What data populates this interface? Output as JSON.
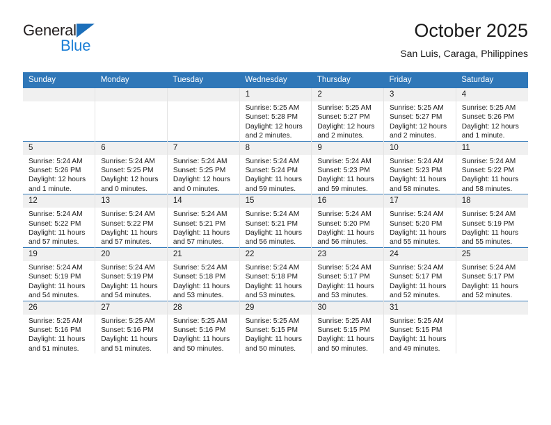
{
  "brand": {
    "name_top": "General",
    "name_bottom": "Blue",
    "triangle_color": "#1c6fba",
    "blue_text_color": "#1c7fd6"
  },
  "header": {
    "title": "October 2025",
    "subtitle": "San Luis, Caraga, Philippines",
    "header_bg": "#2f77b8",
    "header_text_color": "#ffffff",
    "daynum_bg": "#f0f0f0"
  },
  "weekday_headers": [
    "Sunday",
    "Monday",
    "Tuesday",
    "Wednesday",
    "Thursday",
    "Friday",
    "Saturday"
  ],
  "labels": {
    "sunrise": "Sunrise:",
    "sunset": "Sunset:",
    "daylight": "Daylight:"
  },
  "weeks": [
    [
      {
        "day": "",
        "sunrise": "",
        "sunset": "",
        "daylight_line1": "",
        "daylight_line2": ""
      },
      {
        "day": "",
        "sunrise": "",
        "sunset": "",
        "daylight_line1": "",
        "daylight_line2": ""
      },
      {
        "day": "",
        "sunrise": "",
        "sunset": "",
        "daylight_line1": "",
        "daylight_line2": ""
      },
      {
        "day": "1",
        "sunrise": "Sunrise: 5:25 AM",
        "sunset": "Sunset: 5:28 PM",
        "daylight_line1": "Daylight: 12 hours",
        "daylight_line2": "and 2 minutes."
      },
      {
        "day": "2",
        "sunrise": "Sunrise: 5:25 AM",
        "sunset": "Sunset: 5:27 PM",
        "daylight_line1": "Daylight: 12 hours",
        "daylight_line2": "and 2 minutes."
      },
      {
        "day": "3",
        "sunrise": "Sunrise: 5:25 AM",
        "sunset": "Sunset: 5:27 PM",
        "daylight_line1": "Daylight: 12 hours",
        "daylight_line2": "and 2 minutes."
      },
      {
        "day": "4",
        "sunrise": "Sunrise: 5:25 AM",
        "sunset": "Sunset: 5:26 PM",
        "daylight_line1": "Daylight: 12 hours",
        "daylight_line2": "and 1 minute."
      }
    ],
    [
      {
        "day": "5",
        "sunrise": "Sunrise: 5:24 AM",
        "sunset": "Sunset: 5:26 PM",
        "daylight_line1": "Daylight: 12 hours",
        "daylight_line2": "and 1 minute."
      },
      {
        "day": "6",
        "sunrise": "Sunrise: 5:24 AM",
        "sunset": "Sunset: 5:25 PM",
        "daylight_line1": "Daylight: 12 hours",
        "daylight_line2": "and 0 minutes."
      },
      {
        "day": "7",
        "sunrise": "Sunrise: 5:24 AM",
        "sunset": "Sunset: 5:25 PM",
        "daylight_line1": "Daylight: 12 hours",
        "daylight_line2": "and 0 minutes."
      },
      {
        "day": "8",
        "sunrise": "Sunrise: 5:24 AM",
        "sunset": "Sunset: 5:24 PM",
        "daylight_line1": "Daylight: 11 hours",
        "daylight_line2": "and 59 minutes."
      },
      {
        "day": "9",
        "sunrise": "Sunrise: 5:24 AM",
        "sunset": "Sunset: 5:23 PM",
        "daylight_line1": "Daylight: 11 hours",
        "daylight_line2": "and 59 minutes."
      },
      {
        "day": "10",
        "sunrise": "Sunrise: 5:24 AM",
        "sunset": "Sunset: 5:23 PM",
        "daylight_line1": "Daylight: 11 hours",
        "daylight_line2": "and 58 minutes."
      },
      {
        "day": "11",
        "sunrise": "Sunrise: 5:24 AM",
        "sunset": "Sunset: 5:22 PM",
        "daylight_line1": "Daylight: 11 hours",
        "daylight_line2": "and 58 minutes."
      }
    ],
    [
      {
        "day": "12",
        "sunrise": "Sunrise: 5:24 AM",
        "sunset": "Sunset: 5:22 PM",
        "daylight_line1": "Daylight: 11 hours",
        "daylight_line2": "and 57 minutes."
      },
      {
        "day": "13",
        "sunrise": "Sunrise: 5:24 AM",
        "sunset": "Sunset: 5:22 PM",
        "daylight_line1": "Daylight: 11 hours",
        "daylight_line2": "and 57 minutes."
      },
      {
        "day": "14",
        "sunrise": "Sunrise: 5:24 AM",
        "sunset": "Sunset: 5:21 PM",
        "daylight_line1": "Daylight: 11 hours",
        "daylight_line2": "and 57 minutes."
      },
      {
        "day": "15",
        "sunrise": "Sunrise: 5:24 AM",
        "sunset": "Sunset: 5:21 PM",
        "daylight_line1": "Daylight: 11 hours",
        "daylight_line2": "and 56 minutes."
      },
      {
        "day": "16",
        "sunrise": "Sunrise: 5:24 AM",
        "sunset": "Sunset: 5:20 PM",
        "daylight_line1": "Daylight: 11 hours",
        "daylight_line2": "and 56 minutes."
      },
      {
        "day": "17",
        "sunrise": "Sunrise: 5:24 AM",
        "sunset": "Sunset: 5:20 PM",
        "daylight_line1": "Daylight: 11 hours",
        "daylight_line2": "and 55 minutes."
      },
      {
        "day": "18",
        "sunrise": "Sunrise: 5:24 AM",
        "sunset": "Sunset: 5:19 PM",
        "daylight_line1": "Daylight: 11 hours",
        "daylight_line2": "and 55 minutes."
      }
    ],
    [
      {
        "day": "19",
        "sunrise": "Sunrise: 5:24 AM",
        "sunset": "Sunset: 5:19 PM",
        "daylight_line1": "Daylight: 11 hours",
        "daylight_line2": "and 54 minutes."
      },
      {
        "day": "20",
        "sunrise": "Sunrise: 5:24 AM",
        "sunset": "Sunset: 5:19 PM",
        "daylight_line1": "Daylight: 11 hours",
        "daylight_line2": "and 54 minutes."
      },
      {
        "day": "21",
        "sunrise": "Sunrise: 5:24 AM",
        "sunset": "Sunset: 5:18 PM",
        "daylight_line1": "Daylight: 11 hours",
        "daylight_line2": "and 53 minutes."
      },
      {
        "day": "22",
        "sunrise": "Sunrise: 5:24 AM",
        "sunset": "Sunset: 5:18 PM",
        "daylight_line1": "Daylight: 11 hours",
        "daylight_line2": "and 53 minutes."
      },
      {
        "day": "23",
        "sunrise": "Sunrise: 5:24 AM",
        "sunset": "Sunset: 5:17 PM",
        "daylight_line1": "Daylight: 11 hours",
        "daylight_line2": "and 53 minutes."
      },
      {
        "day": "24",
        "sunrise": "Sunrise: 5:24 AM",
        "sunset": "Sunset: 5:17 PM",
        "daylight_line1": "Daylight: 11 hours",
        "daylight_line2": "and 52 minutes."
      },
      {
        "day": "25",
        "sunrise": "Sunrise: 5:24 AM",
        "sunset": "Sunset: 5:17 PM",
        "daylight_line1": "Daylight: 11 hours",
        "daylight_line2": "and 52 minutes."
      }
    ],
    [
      {
        "day": "26",
        "sunrise": "Sunrise: 5:25 AM",
        "sunset": "Sunset: 5:16 PM",
        "daylight_line1": "Daylight: 11 hours",
        "daylight_line2": "and 51 minutes."
      },
      {
        "day": "27",
        "sunrise": "Sunrise: 5:25 AM",
        "sunset": "Sunset: 5:16 PM",
        "daylight_line1": "Daylight: 11 hours",
        "daylight_line2": "and 51 minutes."
      },
      {
        "day": "28",
        "sunrise": "Sunrise: 5:25 AM",
        "sunset": "Sunset: 5:16 PM",
        "daylight_line1": "Daylight: 11 hours",
        "daylight_line2": "and 50 minutes."
      },
      {
        "day": "29",
        "sunrise": "Sunrise: 5:25 AM",
        "sunset": "Sunset: 5:15 PM",
        "daylight_line1": "Daylight: 11 hours",
        "daylight_line2": "and 50 minutes."
      },
      {
        "day": "30",
        "sunrise": "Sunrise: 5:25 AM",
        "sunset": "Sunset: 5:15 PM",
        "daylight_line1": "Daylight: 11 hours",
        "daylight_line2": "and 50 minutes."
      },
      {
        "day": "31",
        "sunrise": "Sunrise: 5:25 AM",
        "sunset": "Sunset: 5:15 PM",
        "daylight_line1": "Daylight: 11 hours",
        "daylight_line2": "and 49 minutes."
      },
      {
        "day": "",
        "sunrise": "",
        "sunset": "",
        "daylight_line1": "",
        "daylight_line2": ""
      }
    ]
  ]
}
